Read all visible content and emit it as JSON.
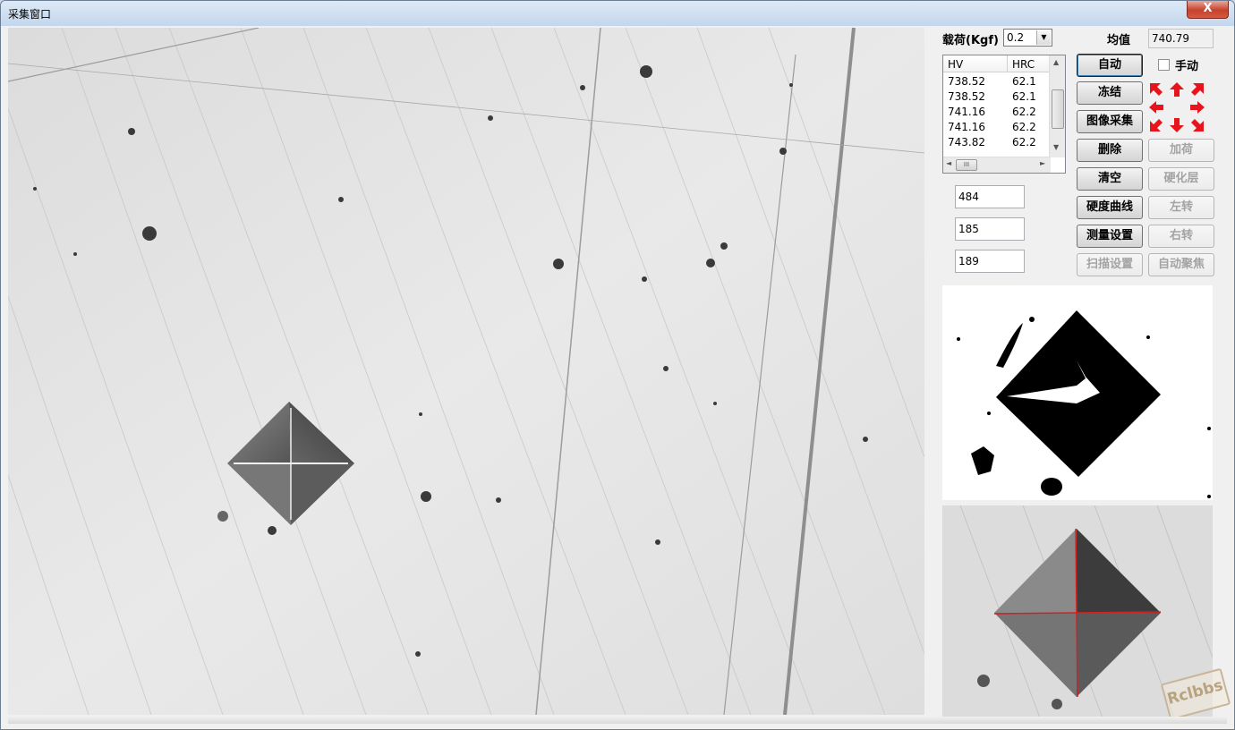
{
  "window": {
    "title": "采集窗口",
    "close_symbol": "X"
  },
  "load": {
    "label": "载荷(Kgf)",
    "value": "0.2"
  },
  "mean": {
    "label": "均值",
    "value": "740.79"
  },
  "table": {
    "headers": [
      "HV",
      "HRC"
    ],
    "rows": [
      [
        "738.52",
        "62.1"
      ],
      [
        "738.52",
        "62.1"
      ],
      [
        "741.16",
        "62.2"
      ],
      [
        "741.16",
        "62.2"
      ],
      [
        "743.82",
        "62.2"
      ]
    ],
    "hscroll_thumb": "III"
  },
  "fields": [
    "484",
    "185",
    "189"
  ],
  "buttons": {
    "auto": "自动",
    "manual": "手动",
    "freeze": "冻结",
    "capture": "图像采集",
    "delete": "删除",
    "load": "加荷",
    "clear": "清空",
    "hardened_layer": "硬化层",
    "hardness_curve": "硬度曲线",
    "rotate_left": "左转",
    "measure_settings": "测量设置",
    "rotate_right": "右转",
    "scan_settings": "扫描设置",
    "auto_focus": "自动聚焦"
  },
  "arrow_pad": [
    "up-left",
    "up",
    "up-right",
    "left",
    "right",
    "down-left",
    "down",
    "down-right"
  ],
  "colors": {
    "arrow_red": "#e8141c",
    "crosshair_red": "#d42020"
  },
  "watermark": "Rclbbs"
}
